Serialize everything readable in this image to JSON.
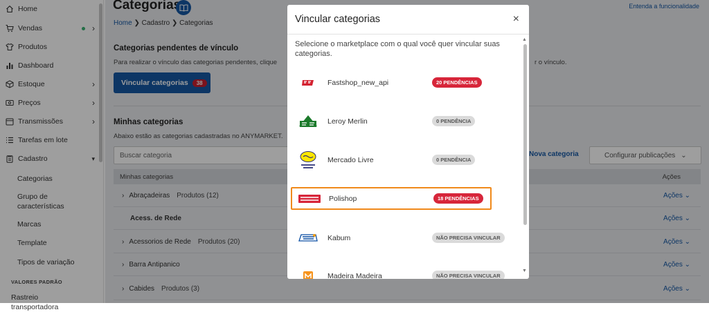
{
  "sidebar": {
    "items": [
      {
        "label": "Home",
        "icon": "home-icon"
      },
      {
        "label": "Vendas",
        "icon": "cart-icon",
        "dot": true,
        "chevron": "right"
      },
      {
        "label": "Produtos",
        "icon": "shirt-icon"
      },
      {
        "label": "Dashboard",
        "icon": "bar-chart-icon"
      },
      {
        "label": "Estoque",
        "icon": "box-icon",
        "chevron": "right"
      },
      {
        "label": "Preços",
        "icon": "price-icon",
        "chevron": "right"
      },
      {
        "label": "Transmissões",
        "icon": "calendar-icon",
        "chevron": "right"
      },
      {
        "label": "Tarefas em lote",
        "icon": "list-icon"
      },
      {
        "label": "Cadastro",
        "icon": "clipboard-icon",
        "chevron": "down"
      }
    ],
    "subitems": [
      "Categorias",
      "Grupo de características",
      "Marcas",
      "Template",
      "Tipos de variação"
    ],
    "section": "VALORES PADRÃO",
    "last": "Rastreio transportadora"
  },
  "page": {
    "title": "Categorias",
    "help_link": "Entenda a funcionalidade",
    "breadcrumb": {
      "home": "Home",
      "sep1": "❯",
      "mid": "Cadastro",
      "sep2": "❯",
      "current": "Categorias"
    },
    "pending_title": "Categorias pendentes de vínculo",
    "pending_desc": "Para realizar o vínculo das categorias pendentes, clique",
    "pending_desc_end": "r o vínculo.",
    "link_button": "Vincular categorias",
    "link_count": "38",
    "my_title": "Minhas categorias",
    "my_desc": "Abaixo estão as categorias cadastradas no ANYMARKET.",
    "search_placeholder": "Buscar categoria",
    "new_button": "Nova categoria",
    "config_button": "Configurar publicações",
    "table_header": "Minhas categorias",
    "actions_header": "Ações",
    "rows": [
      {
        "name": "Abraçadeiras",
        "products": "Produtos (12)",
        "expand": true,
        "bold": false
      },
      {
        "name": "Acess. de Rede",
        "products": "",
        "expand": false,
        "bold": true
      },
      {
        "name": "Acessorios de Rede",
        "products": "Produtos (20)",
        "expand": true,
        "bold": false
      },
      {
        "name": "Barra Antipanico",
        "products": "",
        "expand": true,
        "bold": false
      },
      {
        "name": "Cabides",
        "products": "Produtos (3)",
        "expand": true,
        "bold": false
      }
    ],
    "row_action": "Ações"
  },
  "modal": {
    "title": "Vincular categorias",
    "close": "×",
    "description": "Selecione o marketplace com o qual você quer vincular suas categorias.",
    "marketplaces": [
      {
        "name": "Fastshop_new_api",
        "badge": "20 PENDÊNCIAS",
        "badge_type": "red",
        "logo": "fastshop-logo",
        "selected": false
      },
      {
        "name": "Leroy Merlin",
        "badge": "0 PENDÊNCIA",
        "badge_type": "grey",
        "logo": "leroy-merlin-logo",
        "selected": false
      },
      {
        "name": "Mercado Livre",
        "badge": "0 PENDÊNCIA",
        "badge_type": "grey",
        "logo": "mercado-livre-logo",
        "selected": false
      },
      {
        "name": "Polishop",
        "badge": "18 PENDÊNCIAS",
        "badge_type": "red",
        "logo": "polishop-logo",
        "selected": true
      },
      {
        "name": "Kabum",
        "badge": "NÃO PRECISA VINCULAR",
        "badge_type": "grey",
        "logo": "kabum-logo",
        "selected": false
      },
      {
        "name": "Madeira Madeira",
        "badge": "NÃO PRECISA VINCULAR",
        "badge_type": "grey",
        "logo": "madeira-madeira-logo",
        "selected": false
      }
    ]
  },
  "colors": {
    "primary": "#1657a3",
    "danger": "#d7263a",
    "highlight": "#f0891a",
    "success": "#3bb273"
  }
}
